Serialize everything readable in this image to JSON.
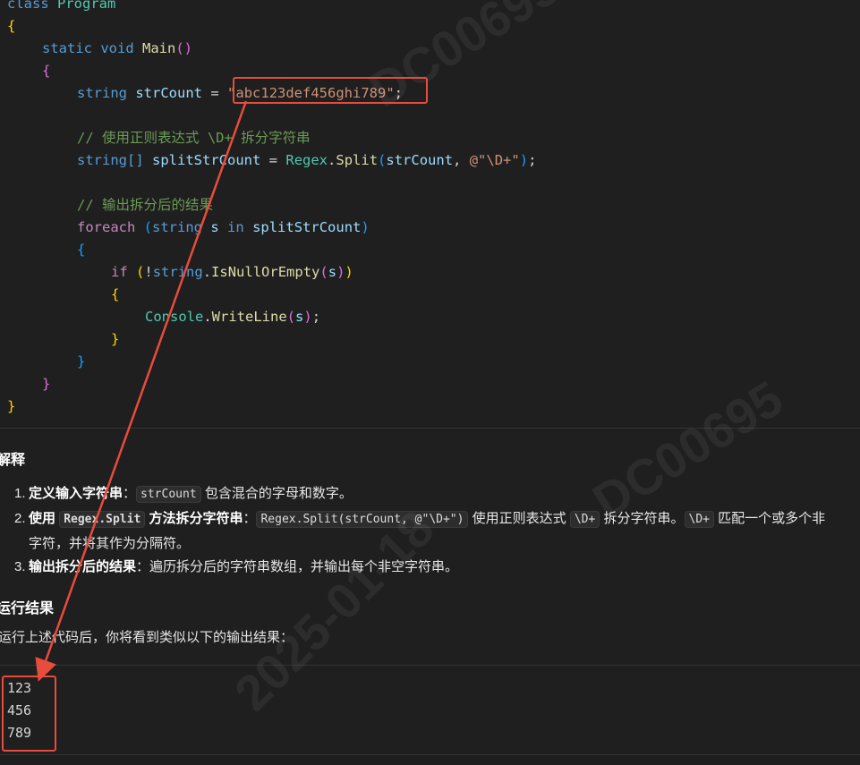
{
  "code": {
    "line0_kw": "class",
    "line0_name": "Program",
    "line2_static": "static",
    "line2_void": "void",
    "line2_main": "Main",
    "line4_type": "string",
    "line4_var": "strCount",
    "line4_value": "\"abc123def456ghi789\"",
    "line6_comment": "// 使用正则表达式 \\D+ 拆分字符串",
    "line7_type": "string[]",
    "line7_var": "splitStrCount",
    "line7_class": "Regex",
    "line7_method": "Split",
    "line7_arg": "strCount",
    "line7_pattern": "@\"\\D+\"",
    "line9_comment": "// 输出拆分后的结果",
    "line10_foreach": "foreach",
    "line10_type": "string",
    "line10_s": "s",
    "line10_in": "in",
    "line10_coll": "splitStrCount",
    "line12_if": "if",
    "line12_type": "string",
    "line12_method": "IsNullOrEmpty",
    "line12_arg": "s",
    "line14_class": "Console",
    "line14_method": "WriteLine",
    "line14_arg": "s"
  },
  "explanation": {
    "heading": "解释",
    "item1_num": "1.",
    "item1_title": "定义输入字符串",
    "item1_colon": "：",
    "item1_code": "strCount",
    "item1_text": "包含混合的字母和数字。",
    "item2_num": "2.",
    "item2_prefix": "使用",
    "item2_code1": "Regex.Split",
    "item2_title": "方法拆分字符串",
    "item2_colon": "：",
    "item2_code2": "Regex.Split(strCount, @\"\\D+\")",
    "item2_text1": "使用正则表达式",
    "item2_code3": "\\D+",
    "item2_text2": "拆分字符串。",
    "item2_code4": "\\D+",
    "item2_text3": "匹配一个或多个非",
    "item2_cont": "字符，并将其作为分隔符。",
    "item3_num": "3.",
    "item3_title": "输出拆分后的结果",
    "item3_colon": "：",
    "item3_text": "遍历拆分后的字符串数组，并输出每个非空字符串。"
  },
  "result": {
    "heading": "运行结果",
    "intro": "运行上述代码后，你将看到类似以下的输出结果：",
    "lines": [
      "123",
      "456",
      "789"
    ]
  },
  "watermark": {
    "id": "DC00695",
    "date": "2025-01-18"
  },
  "colors": {
    "annotation": "#e74c3c",
    "background": "#1f1f1f"
  }
}
